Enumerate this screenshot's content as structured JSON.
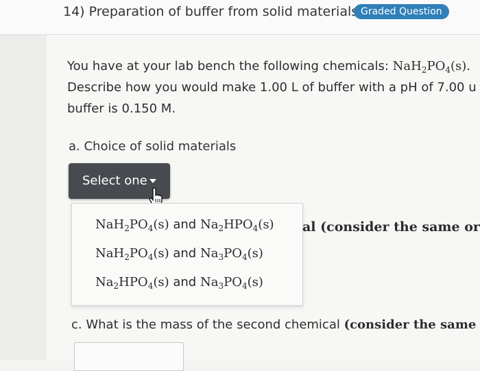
{
  "question": {
    "title": "14) Preparation of buffer from solid materials",
    "badge": "Graded Question"
  },
  "body": {
    "line1_prefix": "You have at your lab bench the following chemicals: ",
    "line1_formula": [
      "NaH",
      "2",
      "PO",
      "4",
      "(s)."
    ],
    "line2": "Describe how you would make 1.00 L of buffer with a pH of 7.00 u",
    "line3": "buffer is 0.150 M."
  },
  "part_a": {
    "label": "a. Choice of solid materials",
    "select_label": "Select one",
    "options": [
      {
        "c1": [
          "NaH",
          "2",
          "PO",
          "4",
          "(s)"
        ],
        "join": " and ",
        "c2": [
          "Na",
          "2",
          "HPO",
          "4",
          "(s)"
        ]
      },
      {
        "c1": [
          "NaH",
          "2",
          "PO",
          "4",
          "(s)"
        ],
        "join": " and ",
        "c2": [
          "Na",
          "3",
          "PO",
          "4",
          "(s)"
        ]
      },
      {
        "c1": [
          "Na",
          "2",
          "HPO",
          "4",
          "(s)"
        ],
        "join": " and ",
        "c2": [
          "Na",
          "3",
          "PO",
          "4",
          "(s)"
        ]
      }
    ]
  },
  "part_b": {
    "partial_text": "al (consider the same orde"
  },
  "part_c": {
    "text_prefix": "c. What is the mass of the second chemical ",
    "text_bold": "(consider the same or"
  }
}
